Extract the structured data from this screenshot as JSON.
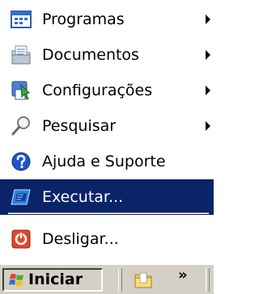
{
  "start_menu": {
    "items": [
      {
        "label": "Programas",
        "icon": "programs-icon",
        "submenu": true
      },
      {
        "label": "Documentos",
        "icon": "documents-icon",
        "submenu": true
      },
      {
        "label": "Configurações",
        "icon": "settings-icon",
        "submenu": true
      },
      {
        "label": "Pesquisar",
        "icon": "search-icon",
        "submenu": true
      },
      {
        "label": "Ajuda e Suporte",
        "icon": "help-icon",
        "submenu": false
      },
      {
        "label": "Executar...",
        "icon": "run-icon",
        "submenu": false,
        "selected": true
      },
      {
        "label": "Desligar...",
        "icon": "shutdown-icon",
        "submenu": false
      }
    ],
    "selection_color": "#0a246a"
  },
  "taskbar": {
    "start_label": "Iniciar",
    "quick_launch_icon": "folder-icon",
    "overflow_label": "»",
    "background": "#d4d0c8"
  }
}
